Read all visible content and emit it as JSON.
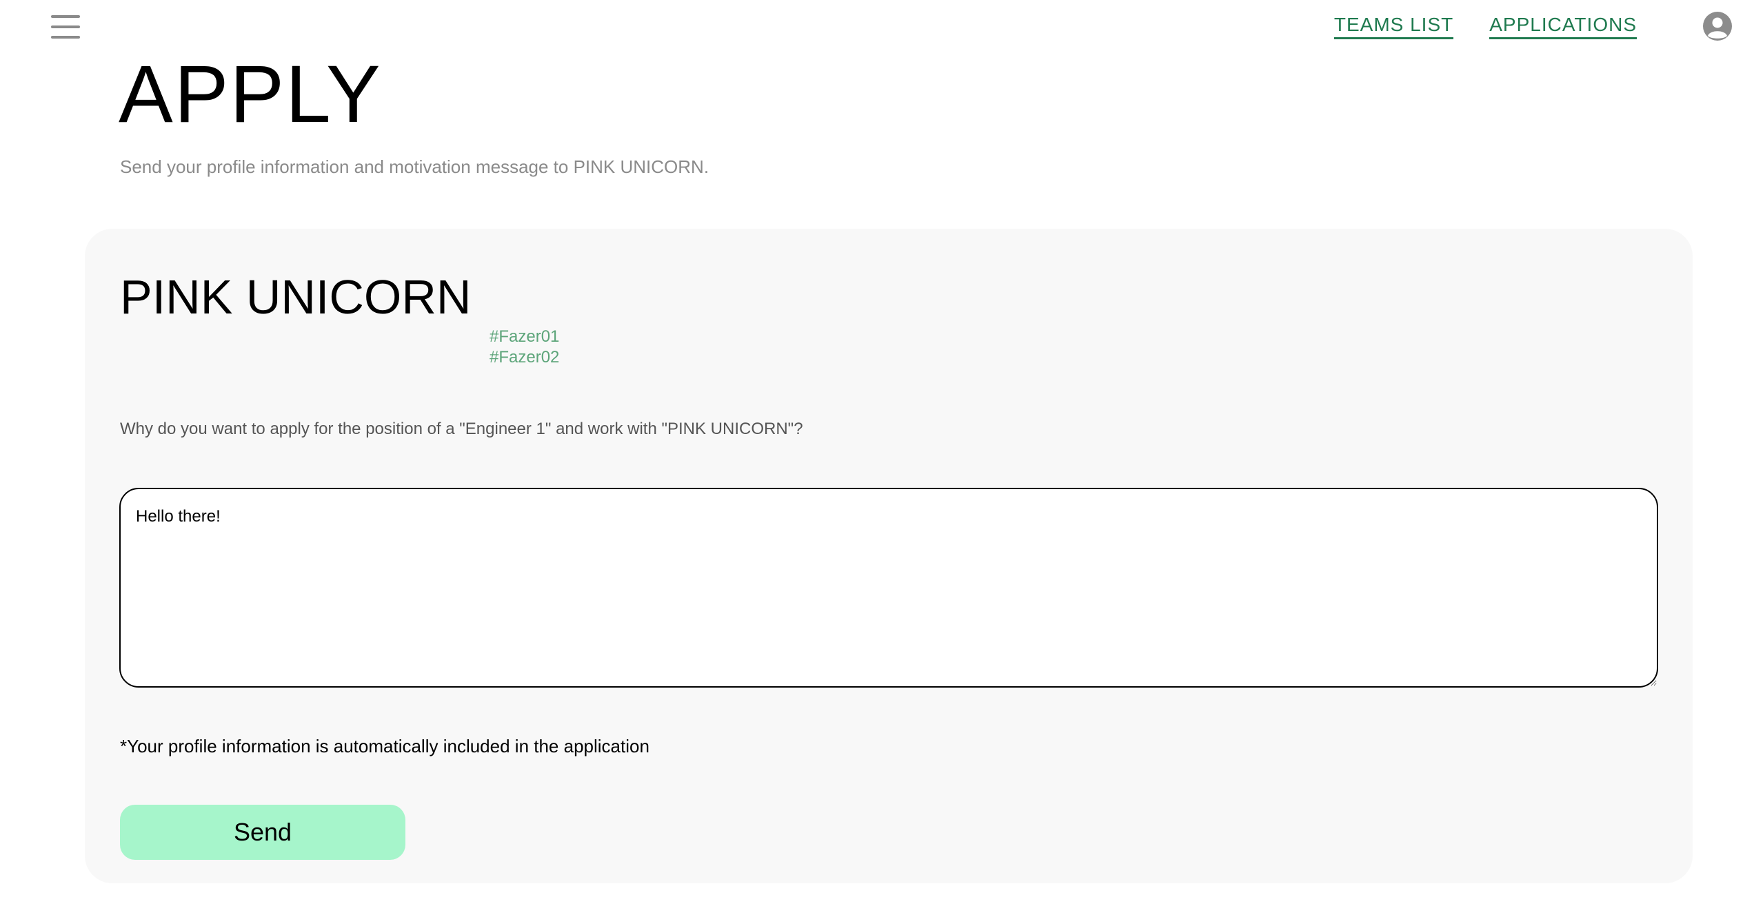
{
  "nav": {
    "links": [
      {
        "label": "TEAMS LIST"
      },
      {
        "label": "APPLICATIONS"
      }
    ],
    "menu_icon": "hamburger-menu-icon",
    "avatar_icon": "user-account-icon",
    "link_color": "#1f7a4f"
  },
  "header": {
    "title": "APPLY",
    "subtitle": "Send your profile information and motivation message to PINK UNICORN."
  },
  "card": {
    "team_name": "PINK UNICORN",
    "tags": [
      "#Fazer01",
      "#Fazer02"
    ],
    "question": "Why do you want to apply for the position of a \"Engineer 1\" and work with \"PINK UNICORN\"?",
    "message_value": "Hello there!",
    "note": "*Your profile information is automatically included in the application",
    "send_label": "Send",
    "send_color": "#a6f5cb"
  }
}
